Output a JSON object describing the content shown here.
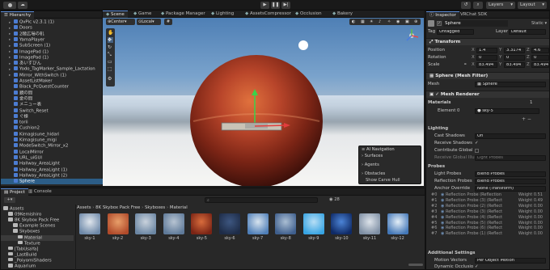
{
  "toolbar": {
    "layers_label": "Layers",
    "layout_label": "Layout"
  },
  "hierarchy": {
    "tab": "Hierarchy",
    "items": [
      {
        "label": "QvPic v2.3.1 (1)",
        "depth": 1
      },
      {
        "label": "Doors",
        "depth": 1
      },
      {
        "label": "2階広場の机",
        "depth": 1
      },
      {
        "label": "YamaPlayer",
        "depth": 1
      },
      {
        "label": "SubScreen (1)",
        "depth": 1
      },
      {
        "label": "ImagePad (1)",
        "depth": 1
      },
      {
        "label": "ImagePad (1)",
        "depth": 1
      },
      {
        "label": "あいすびん",
        "depth": 1
      },
      {
        "label": "Yodo_TagMarker_Sample_Lactation",
        "depth": 1
      },
      {
        "label": "Mirror_WithSwitch (1)",
        "depth": 1
      },
      {
        "label": "AssetListMaker",
        "depth": 1
      },
      {
        "label": "Black_PcQuestCounter",
        "depth": 1
      },
      {
        "label": "鏡の間",
        "depth": 1
      },
      {
        "label": "金の間",
        "depth": 1
      },
      {
        "label": "メニュー表",
        "depth": 1
      },
      {
        "label": "Switch_Reset",
        "depth": 1
      },
      {
        "label": "ぐ様",
        "depth": 1
      },
      {
        "label": "torii",
        "depth": 1
      },
      {
        "label": "Cushion2",
        "depth": 1
      },
      {
        "label": "Kimagisune_hidari",
        "depth": 1
      },
      {
        "label": "Kimagisune_migi",
        "depth": 1
      },
      {
        "label": "ModeSwitch_Mirror_x2",
        "depth": 1
      },
      {
        "label": "LocalMirror",
        "depth": 1
      },
      {
        "label": "URL_uiGUI",
        "depth": 1
      },
      {
        "label": "Hallway_AreaLight",
        "depth": 1
      },
      {
        "label": "Hallway_AreaLight (1)",
        "depth": 1
      },
      {
        "label": "Hallway_AreaLight (2)",
        "depth": 1
      },
      {
        "label": "Sphere",
        "depth": 1
      }
    ],
    "selected_index": 27
  },
  "scene_tabs": [
    {
      "label": "Scene",
      "active": true
    },
    {
      "label": "Game",
      "active": false
    },
    {
      "label": "Package Manager",
      "active": false
    },
    {
      "label": "Lighting",
      "active": false
    },
    {
      "label": "AssetsCompressor",
      "active": false
    },
    {
      "label": "Occlusion",
      "active": false
    },
    {
      "label": "Bakery",
      "active": false
    }
  ],
  "scene": {
    "pivot_label": "Center",
    "space_label": "Local",
    "overlay_title": "AI Navigation",
    "overlay_items": [
      "Surfaces",
      "Agents",
      "Obstacles"
    ],
    "overlay_show_carve": "Show Carve Hull"
  },
  "inspector": {
    "tabs": [
      "Inspector",
      "VRChat SDK"
    ],
    "object_name": "Sphere",
    "static_label": "Static",
    "tag_label": "Tag",
    "tag_value": "Untagged",
    "layer_label": "Layer",
    "layer_value": "Default",
    "transform_title": "Transform",
    "position_label": "Position",
    "position": {
      "x": "1.4",
      "y": "3.3174",
      "z": "4.6"
    },
    "rotation_label": "Rotation",
    "rotation": {
      "x": "0",
      "y": "0",
      "z": "0"
    },
    "scale_label": "Scale",
    "scale": {
      "x": "83.494",
      "y": "83.494",
      "z": "83.494"
    },
    "mesh_filter_title": "Sphere (Mesh Filter)",
    "mesh_label": "Mesh",
    "mesh_value": "Sphere",
    "mesh_renderer_title": "Mesh Renderer",
    "materials_label": "Materials",
    "materials_count": "1",
    "element0_label": "Element 0",
    "element0_value": "sky-5",
    "lighting_label": "Lighting",
    "cast_shadows_label": "Cast Shadows",
    "cast_shadows_value": "On",
    "receive_shadows_label": "Receive Shadows",
    "contribute_gi_label": "Contribute Global",
    "receive_gi_label": "Receive Global Illum",
    "receive_gi_value": "Light Probes",
    "probes_label": "Probes",
    "light_probes_label": "Light Probes",
    "light_probes_value": "Blend Probes",
    "reflection_probes_label": "Reflection Probes",
    "reflection_probes_value": "Blend Probes",
    "anchor_override_label": "Anchor Override",
    "anchor_override_value": "None (Transform)",
    "probe_rows": [
      {
        "id": "#0",
        "label": "Reflection Probe (Reflection",
        "weight": "Weight 0.51"
      },
      {
        "id": "#1",
        "label": "Reflection Probe (3) (Reflect",
        "weight": "Weight 0.49"
      },
      {
        "id": "#2",
        "label": "Reflection Probe (2) (Reflect",
        "weight": "Weight 0.00"
      },
      {
        "id": "#3",
        "label": "Reflection Probe (3) (Reflect",
        "weight": "Weight 0.00"
      },
      {
        "id": "#4",
        "label": "Reflection Probe (4) (Reflect",
        "weight": "Weight 0.00"
      },
      {
        "id": "#5",
        "label": "Reflection Probe (5) (Reflect",
        "weight": "Weight 0.00"
      },
      {
        "id": "#6",
        "label": "Reflection Probe (6) (Reflect",
        "weight": "Weight 0.00"
      },
      {
        "id": "#7",
        "label": "Reflection Probe (1) (Reflect",
        "weight": "Weight 0.00"
      }
    ],
    "additional_settings_label": "Additional Settings",
    "motion_vectors_label": "Motion Vectors",
    "motion_vectors_value": "Per Object Motion",
    "dynamic_occlusion_label": "Dynamic Occlusio"
  },
  "project": {
    "tabs": [
      "Project",
      "Console"
    ],
    "tree": [
      {
        "label": "Assets",
        "depth": 0
      },
      {
        "label": "09Kemishiro",
        "depth": 1
      },
      {
        "label": "8K Skybox Pack Free",
        "depth": 1
      },
      {
        "label": "Example Scenes",
        "depth": 2
      },
      {
        "label": "Skyboxes",
        "depth": 2
      },
      {
        "label": "Material",
        "depth": 3
      },
      {
        "label": "Texture",
        "depth": 3
      },
      {
        "label": "[TabUsaYa]",
        "depth": 1
      },
      {
        "label": "_LastBuild",
        "depth": 1
      },
      {
        "label": "_PoiyomiShaders",
        "depth": 1
      },
      {
        "label": "Aquarium",
        "depth": 1
      }
    ],
    "selected_index": 5,
    "breadcrumb": [
      "Assets",
      "8K Skybox Pack Free",
      "Skyboxes",
      "Material"
    ],
    "asset_count": "28",
    "assets": [
      {
        "label": "sky-1",
        "c1": "#6d88a8",
        "c2": "#dfe5ec"
      },
      {
        "label": "sky-2",
        "c1": "#b04a2a",
        "c2": "#e89f6a"
      },
      {
        "label": "sky-3",
        "c1": "#6b86a3",
        "c2": "#c9d2dc"
      },
      {
        "label": "sky-4",
        "c1": "#5f7a99",
        "c2": "#b7c4d2"
      },
      {
        "label": "sky-5",
        "c1": "#7a2415",
        "c2": "#d86c3c"
      },
      {
        "label": "sky-6",
        "c1": "#1e2c47",
        "c2": "#3d5680"
      },
      {
        "label": "sky-7",
        "c1": "#4f7fb8",
        "c2": "#d7e3ee"
      },
      {
        "label": "sky-8",
        "c1": "#3f5f8d",
        "c2": "#aabed3"
      },
      {
        "label": "sky-9",
        "c1": "#37a4e3",
        "c2": "#b7def5"
      },
      {
        "label": "sky-10",
        "c1": "#0f2a66",
        "c2": "#4c84d6"
      },
      {
        "label": "sky-11",
        "c1": "#7d8ea3",
        "c2": "#dde3ea"
      },
      {
        "label": "sky-12",
        "c1": "#4377b7",
        "c2": "#e3eef7"
      }
    ]
  }
}
